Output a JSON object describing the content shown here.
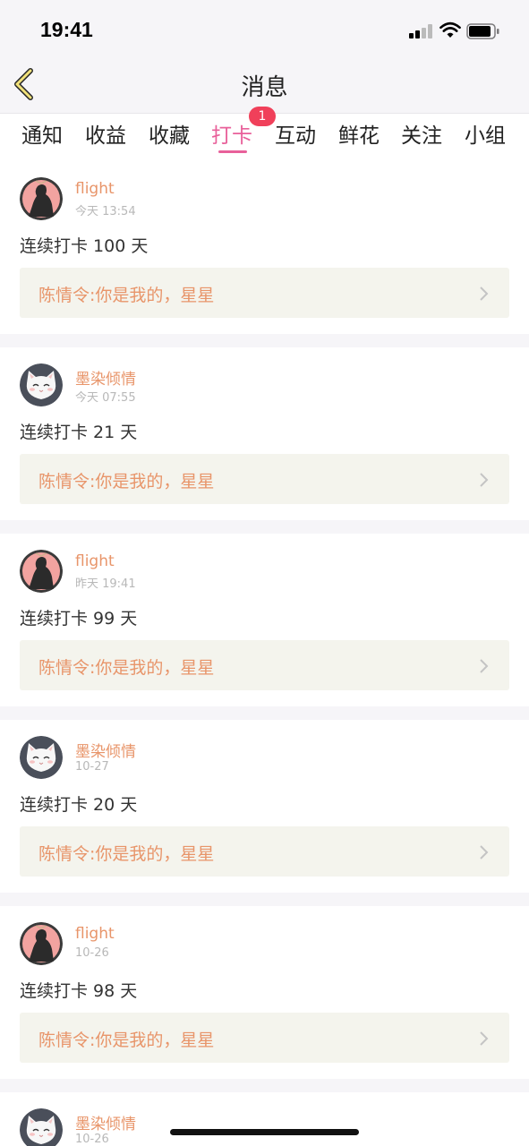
{
  "status_bar": {
    "time": "19:41"
  },
  "header": {
    "title": "消息",
    "back_icon": "chevron-left-icon"
  },
  "tabs": [
    {
      "label": "通知"
    },
    {
      "label": "收益"
    },
    {
      "label": "收藏"
    },
    {
      "label": "打卡",
      "active": true,
      "badge": "1"
    },
    {
      "label": "互动"
    },
    {
      "label": "鲜花"
    },
    {
      "label": "关注"
    },
    {
      "label": "小组"
    }
  ],
  "colors": {
    "accent_pink": "#e8609a",
    "username_orange": "#e8956a",
    "badge_red": "#f0405a",
    "quote_bg": "#f4f4ed"
  },
  "messages": [
    {
      "user": "flight",
      "avatar": "silhouette-avatar",
      "time": "今天 13:54",
      "text": "连续打卡 100 天",
      "quote": "陈情令:你是我的，星星"
    },
    {
      "user": "墨染倾情",
      "avatar": "cat-avatar",
      "time": "今天 07:55",
      "text": "连续打卡 21 天",
      "quote": "陈情令:你是我的，星星"
    },
    {
      "user": "flight",
      "avatar": "silhouette-avatar",
      "time": "昨天 19:41",
      "text": "连续打卡 99 天",
      "quote": "陈情令:你是我的，星星"
    },
    {
      "user": "墨染倾情",
      "avatar": "cat-avatar",
      "time": "10-27",
      "text": "连续打卡 20 天",
      "quote": "陈情令:你是我的，星星"
    },
    {
      "user": "flight",
      "avatar": "silhouette-avatar",
      "time": "10-26",
      "text": "连续打卡 98 天",
      "quote": "陈情令:你是我的，星星"
    },
    {
      "user": "墨染倾情",
      "avatar": "cat-avatar",
      "time": "10-26",
      "text": "",
      "quote": ""
    }
  ]
}
